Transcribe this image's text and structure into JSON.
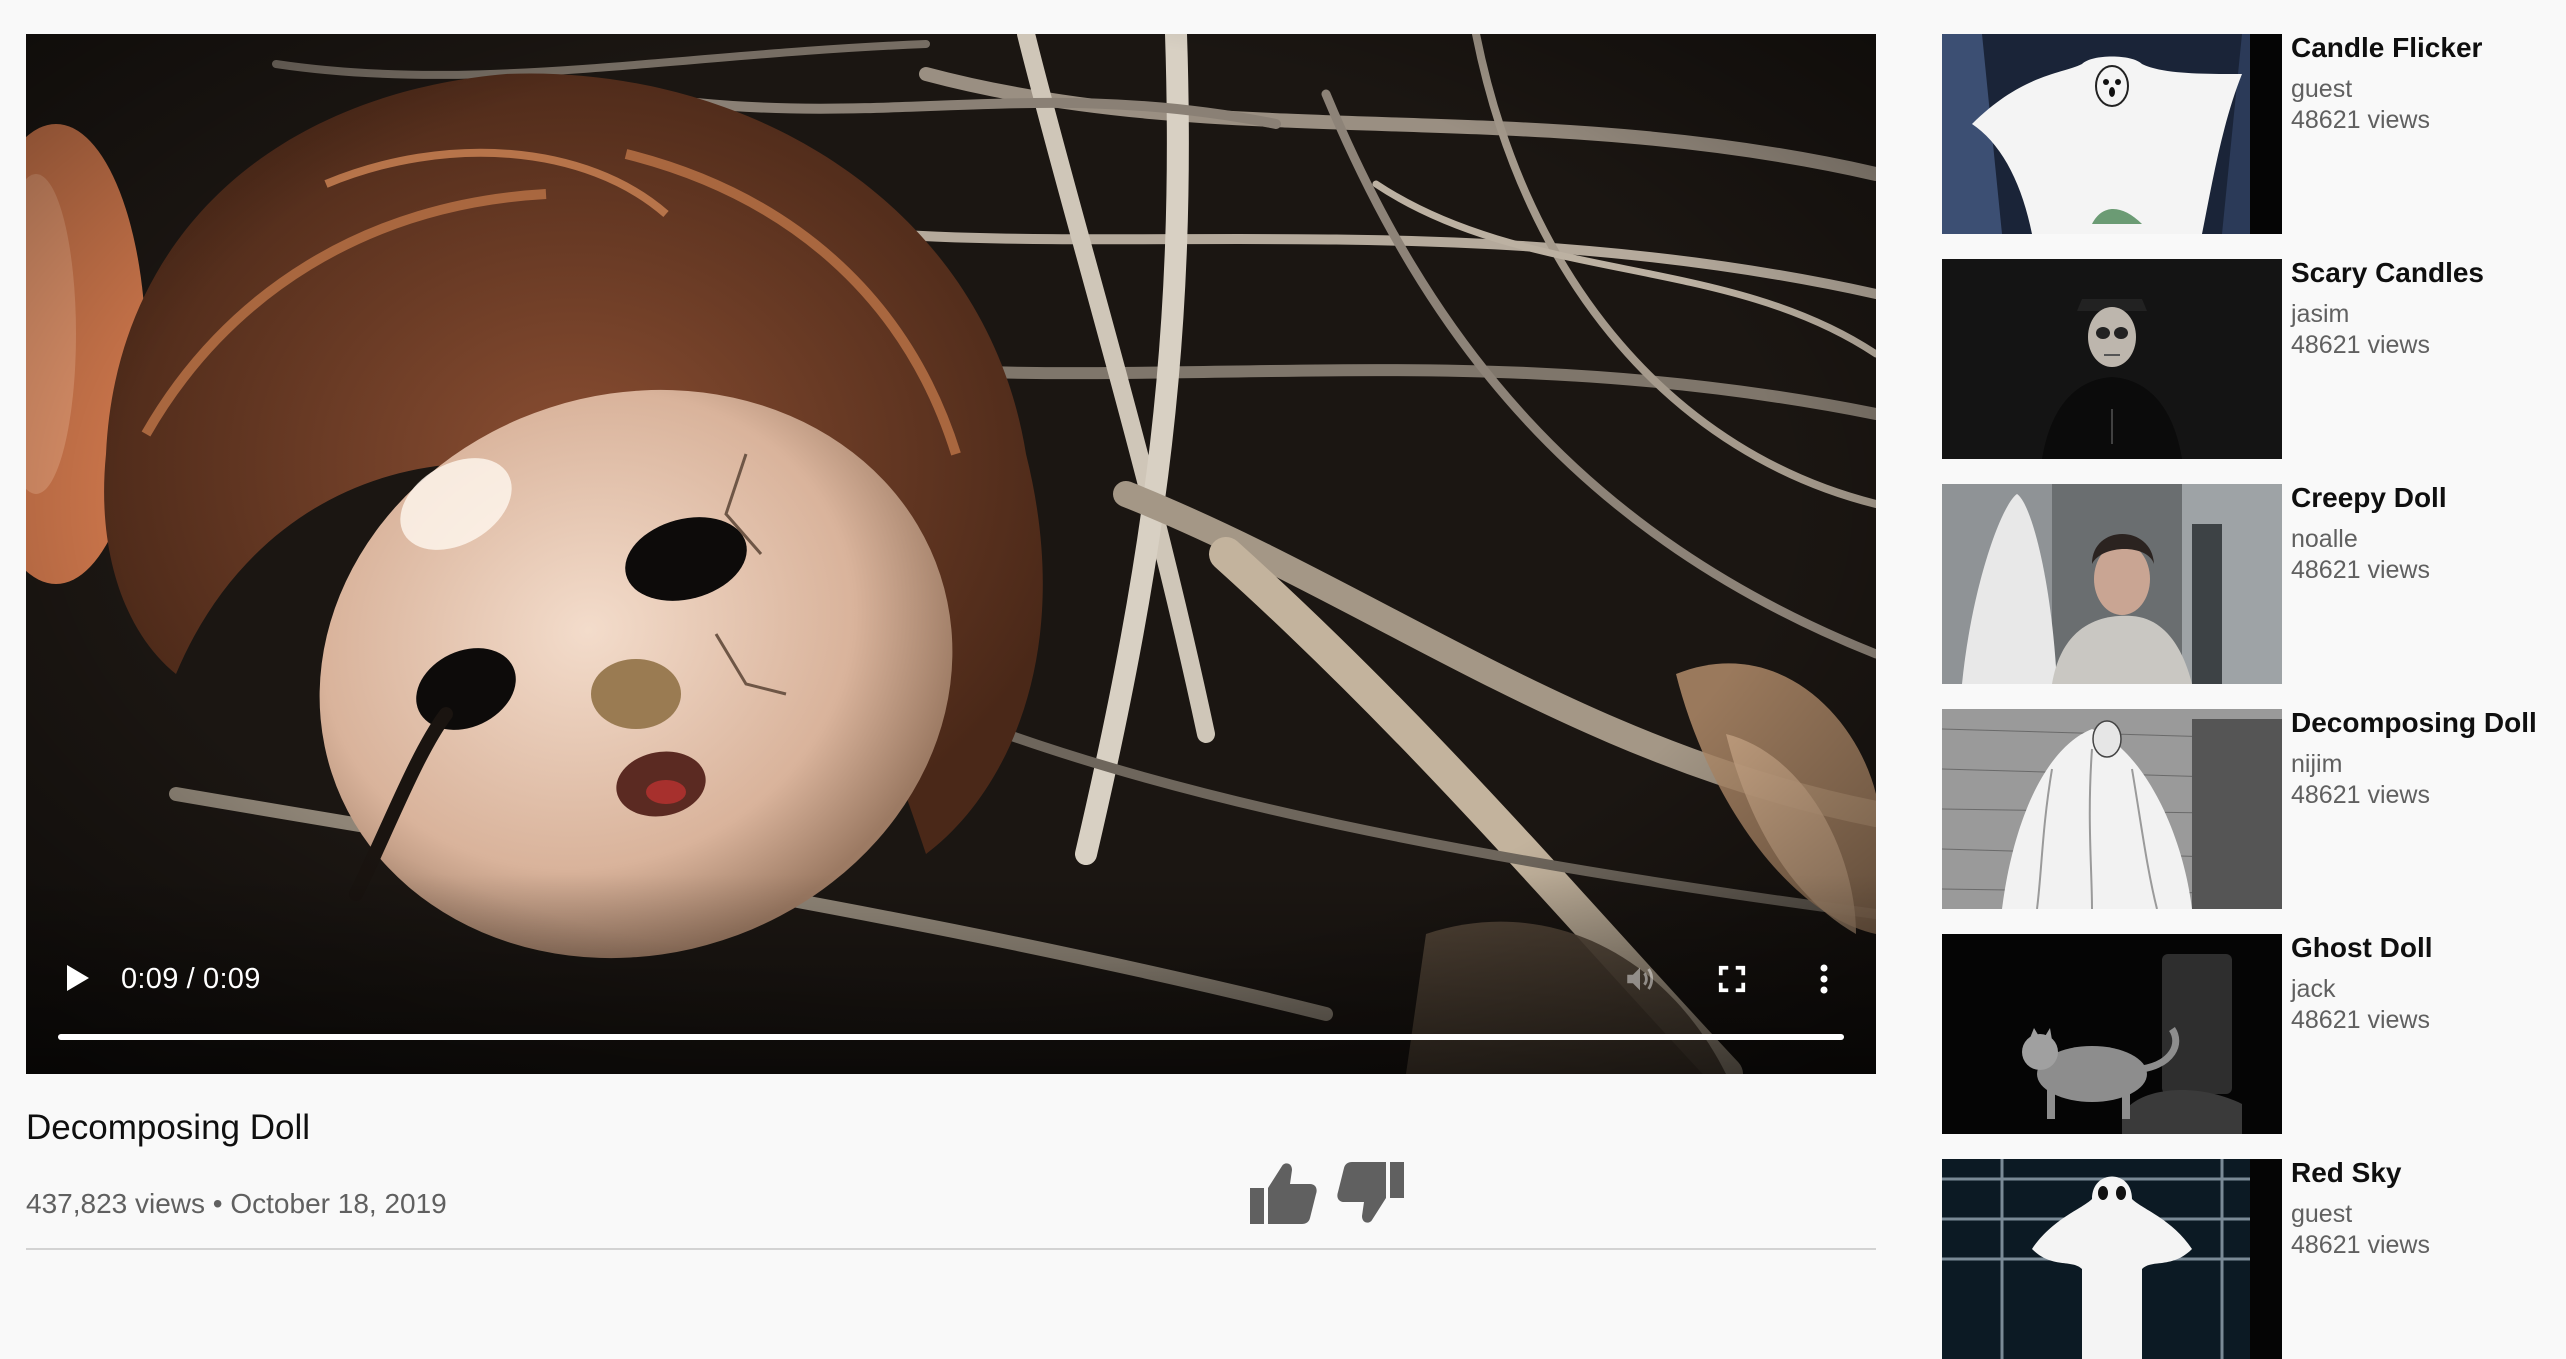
{
  "player": {
    "current_time": "0:09",
    "separator": "/",
    "duration": "0:09",
    "progress_fraction": 1.0,
    "icons": [
      "play-icon",
      "volume-muted-icon",
      "fullscreen-icon",
      "more-options-icon"
    ]
  },
  "video": {
    "title": "Decomposing Doll",
    "meta": "437,823 views • October 18, 2019"
  },
  "actions": {
    "like_icon": "thumbs-up-icon",
    "dislike_icon": "thumbs-down-icon"
  },
  "recommendations": [
    {
      "title": "Candle Flicker",
      "channel": "guest",
      "views": "48621 views"
    },
    {
      "title": "Scary Candles",
      "channel": "jasim",
      "views": "48621 views"
    },
    {
      "title": "Creepy Doll",
      "channel": "noalle",
      "views": "48621 views"
    },
    {
      "title": "Decomposing Doll",
      "channel": "nijim",
      "views": "48621 views"
    },
    {
      "title": "Ghost Doll",
      "channel": "jack",
      "views": "48621 views"
    },
    {
      "title": "Red Sky",
      "channel": "guest",
      "views": "48621 views"
    }
  ],
  "colors": {
    "page_background": "#f9f9f9",
    "title_text": "#0f0f0f",
    "secondary_text": "#606060",
    "action_icon": "#606060"
  }
}
